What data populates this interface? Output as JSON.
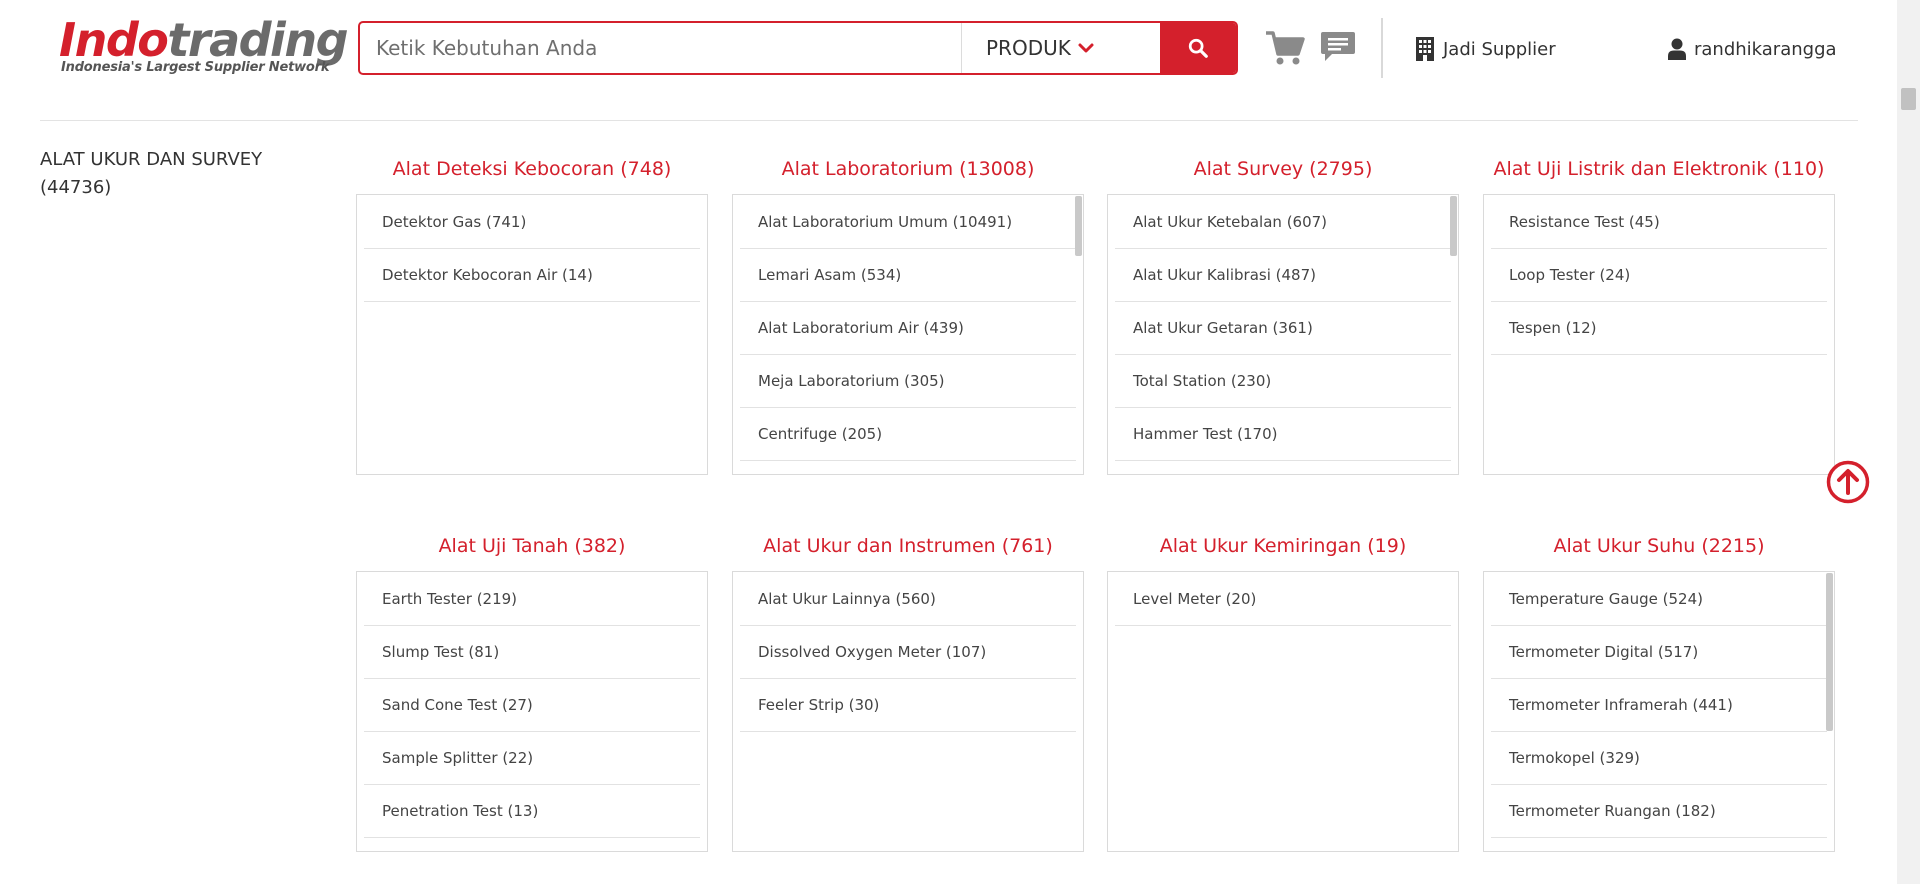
{
  "brand": {
    "name_part1": "Indo",
    "name_part2": "trading",
    "tagline": "Indonesia's Largest Supplier Network",
    "color_primary": "#d4202c",
    "color_secondary": "#6b6b6b"
  },
  "search": {
    "placeholder": "Ketik Kebutuhan Anda",
    "value": "",
    "category": "PRODUK",
    "button_icon": "search-icon"
  },
  "header": {
    "cart_icon": "cart-icon",
    "chat_icon": "chat-icon",
    "supplier_label": "Jadi Supplier",
    "user_name": "randhikarangga"
  },
  "section": {
    "title_line1": "ALAT UKUR DAN SURVEY",
    "title_line2": "(44736)"
  },
  "categories": [
    {
      "title": "Alat Deteksi Kebocoran (748)",
      "has_scroll": false,
      "items": [
        "Detektor Gas (741)",
        "Detektor Kebocoran Air (14)"
      ]
    },
    {
      "title": "Alat Laboratorium (13008)",
      "has_scroll": true,
      "items": [
        "Alat Laboratorium Umum (10491)",
        "Lemari Asam (534)",
        "Alat Laboratorium Air (439)",
        "Meja Laboratorium (305)",
        "Centrifuge (205)"
      ]
    },
    {
      "title": "Alat Survey (2795)",
      "has_scroll": true,
      "items": [
        "Alat Ukur Ketebalan (607)",
        "Alat Ukur Kalibrasi (487)",
        "Alat Ukur Getaran (361)",
        "Total Station (230)",
        "Hammer Test (170)"
      ]
    },
    {
      "title": "Alat Uji Listrik dan Elektronik (110)",
      "has_scroll": false,
      "items": [
        "Resistance Test (45)",
        "Loop Tester (24)",
        "Tespen (12)"
      ]
    },
    {
      "title": "Alat Uji Tanah (382)",
      "has_scroll": false,
      "items": [
        "Earth Tester (219)",
        "Slump Test (81)",
        "Sand Cone Test (27)",
        "Sample Splitter (22)",
        "Penetration Test (13)"
      ]
    },
    {
      "title": "Alat Ukur dan Instrumen (761)",
      "has_scroll": false,
      "items": [
        "Alat Ukur Lainnya (560)",
        "Dissolved Oxygen Meter (107)",
        "Feeler Strip (30)"
      ]
    },
    {
      "title": "Alat Ukur Kemiringan (19)",
      "has_scroll": false,
      "items": [
        "Level Meter (20)"
      ]
    },
    {
      "title": "Alat Ukur Suhu (2215)",
      "has_scroll": true,
      "items": [
        "Temperature Gauge (524)",
        "Termometer Digital (517)",
        "Termometer Inframerah (441)",
        "Termokopel (329)",
        "Termometer Ruangan (182)"
      ]
    }
  ],
  "floating": {
    "back_to_top_icon": "arrow-up-circle-icon"
  }
}
